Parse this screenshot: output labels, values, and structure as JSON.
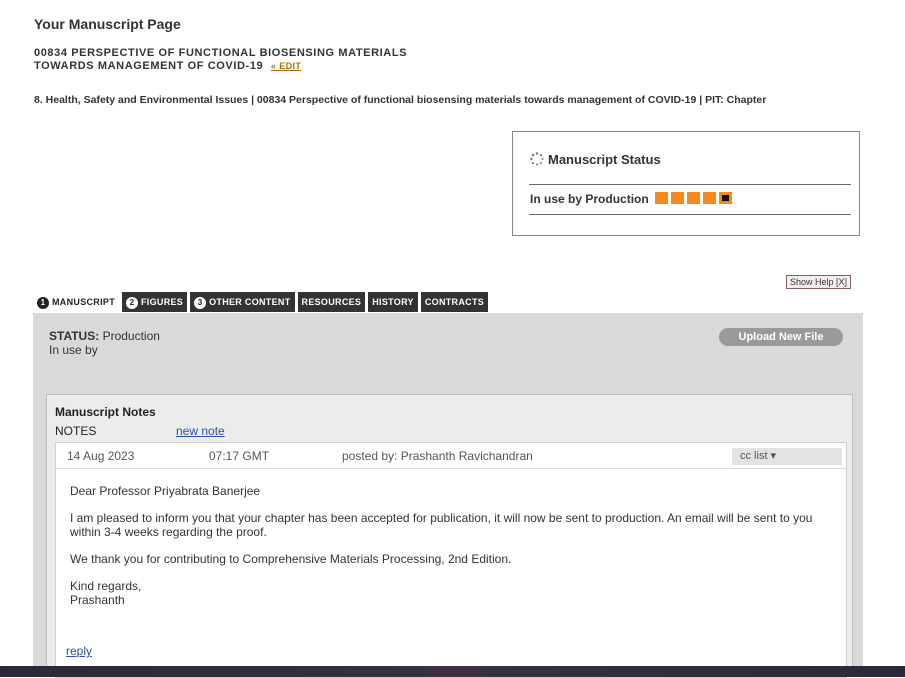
{
  "header": {
    "page_title": "Your Manuscript Page",
    "manuscript_title_line1": "00834 PERSPECTIVE OF FUNCTIONAL BIOSENSING MATERIALS",
    "manuscript_title_line2": "TOWARDS MANAGEMENT OF COVID-19",
    "edit_link": "« EDIT",
    "breadcrumb": "8. Health, Safety and Environmental Issues | 00834 Perspective of functional biosensing materials towards management of COVID-19 | PIT: Chapter"
  },
  "status_box": {
    "title": "Manuscript Status",
    "in_use_label": "In use by",
    "in_use_value": "Production",
    "progress_steps_total": 5,
    "progress_current_step": 5,
    "progress_color": "#f28a1e"
  },
  "help": {
    "label": "Show Help [X]"
  },
  "tabs": [
    {
      "num": "1",
      "label": "MANUSCRIPT",
      "active": true
    },
    {
      "num": "2",
      "label": "FIGURES",
      "active": false
    },
    {
      "num": "3",
      "label": "OTHER CONTENT",
      "active": false
    },
    {
      "label": "RESOURCES",
      "active": false
    },
    {
      "label": "HISTORY",
      "active": false
    },
    {
      "label": "CONTRACTS",
      "active": false
    }
  ],
  "panel": {
    "status_key": "STATUS:",
    "status_value": "Production",
    "in_use_by": "In use by",
    "upload_button": "Upload New File"
  },
  "notes": {
    "title": "Manuscript Notes",
    "label": "NOTES",
    "new_note": "new note",
    "note": {
      "date": "14 Aug 2023",
      "time": "07:17 GMT",
      "author": "posted by: Prashanth Ravichandran",
      "cc_list": "cc list ▾",
      "greeting": "Dear Professor Priyabrata Banerjee",
      "para1": "I am pleased to inform you that your chapter has been accepted for publication, it will now be sent to production. An email will be sent to you within 3-4 weeks regarding the proof.",
      "para2": "We thank you for contributing to Comprehensive Materials Processing, 2nd Edition.",
      "signoff_line1": "Kind regards,",
      "signoff_line2": "Prashanth",
      "reply": "reply"
    }
  }
}
